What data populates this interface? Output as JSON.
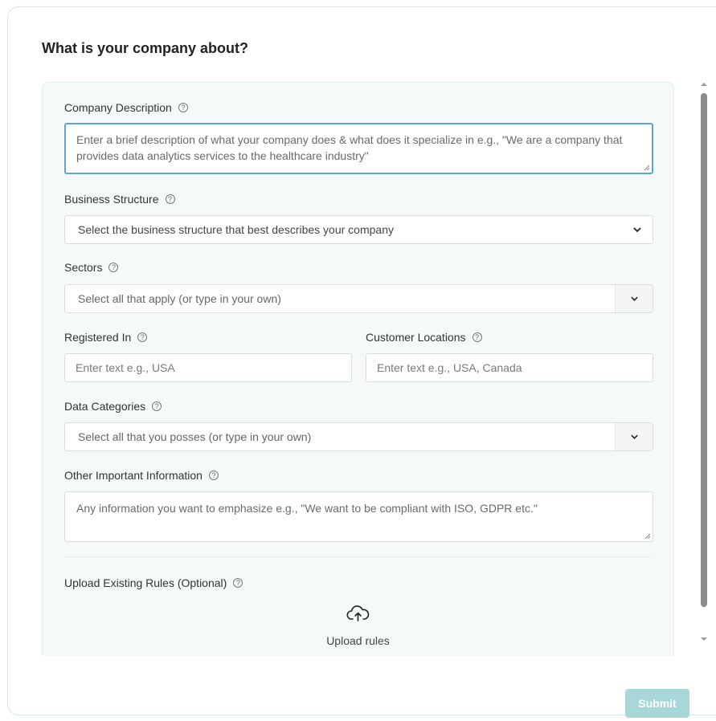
{
  "page": {
    "title": "What is your company about?"
  },
  "form": {
    "company_description": {
      "label": "Company Description",
      "placeholder": "Enter a brief description of what your company does & what does it specialize in e.g., \"We are a company that provides data analytics services to the healthcare industry\""
    },
    "business_structure": {
      "label": "Business Structure",
      "selected": "Select the business structure that best describes your company"
    },
    "sectors": {
      "label": "Sectors",
      "placeholder": "Select all that apply (or type in your own)"
    },
    "registered_in": {
      "label": "Registered In",
      "placeholder": "Enter text e.g., USA"
    },
    "customer_locations": {
      "label": "Customer Locations",
      "placeholder": "Enter text e.g., USA, Canada"
    },
    "data_categories": {
      "label": "Data Categories",
      "placeholder": "Select all that you posses (or type in your own)"
    },
    "other_information": {
      "label": "Other Important Information",
      "placeholder": "Any information you want to emphasize e.g.,  \"We want to be compliant with ISO, GDPR etc.\""
    },
    "upload_rules": {
      "label": "Upload Existing Rules (Optional)",
      "button_label": "Upload rules",
      "icon": "cloud-upload-icon"
    }
  },
  "help_icon": "question-circle-icon",
  "actions": {
    "submit_label": "Submit"
  },
  "colors": {
    "accent": "#a7d7d9",
    "focus_border": "#5aa6d6",
    "panel_background": "#f5f9fa"
  }
}
